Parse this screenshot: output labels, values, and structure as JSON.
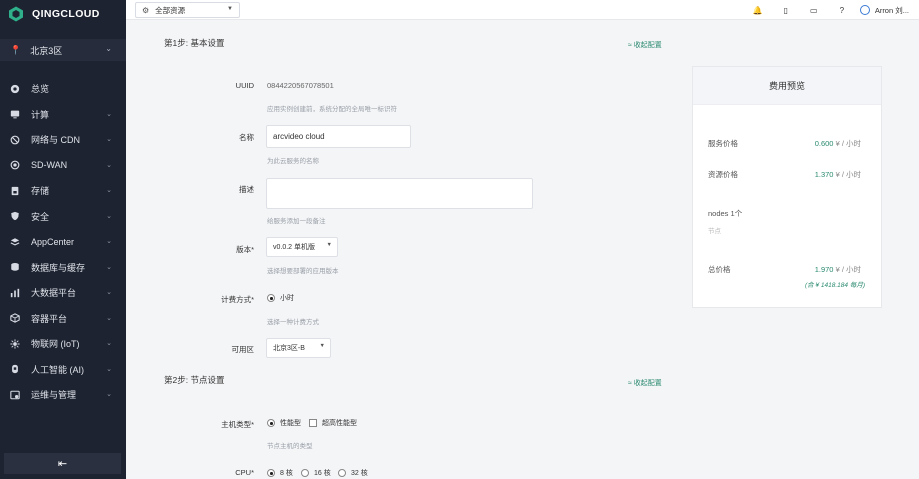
{
  "brand": {
    "name": "QINGCLOUD",
    "color": "#2fb08a"
  },
  "region": {
    "label": "北京3区",
    "icon": "location-pin-icon"
  },
  "nav": [
    {
      "label": "总览",
      "icon": "dashboard-icon",
      "chevron": false
    },
    {
      "label": "计算",
      "icon": "monitor-icon",
      "chevron": true
    },
    {
      "label": "网络与 CDN",
      "icon": "network-icon",
      "chevron": true
    },
    {
      "label": "SD-WAN",
      "icon": "sdwan-icon",
      "chevron": true
    },
    {
      "label": "存储",
      "icon": "storage-icon",
      "chevron": true
    },
    {
      "label": "安全",
      "icon": "shield-icon",
      "chevron": true
    },
    {
      "label": "AppCenter",
      "icon": "layers-icon",
      "chevron": true
    },
    {
      "label": "数据库与缓存",
      "icon": "database-icon",
      "chevron": true
    },
    {
      "label": "大数据平台",
      "icon": "bar-chart-icon",
      "chevron": true
    },
    {
      "label": "容器平台",
      "icon": "container-icon",
      "chevron": true
    },
    {
      "label": "物联网 (IoT)",
      "icon": "iot-icon",
      "chevron": true
    },
    {
      "label": "人工智能 (AI)",
      "icon": "ai-icon",
      "chevron": true
    },
    {
      "label": "运维与管理",
      "icon": "ops-icon",
      "chevron": true
    }
  ],
  "collapse_icon": "⇤",
  "topbar": {
    "resource_select": "全部资源",
    "user": "Arron 刘..."
  },
  "step1": {
    "title": "第1步: 基本设置",
    "collapse": "≈ 收起配置"
  },
  "step2": {
    "title": "第2步: 节点设置",
    "collapse": "≈ 收起配置"
  },
  "form": {
    "uuid_label": "UUID",
    "uuid_value": "0844220567078501",
    "uuid_hint": "应用实例创建前，系统分配的全局唯一标识符",
    "name_label": "名称",
    "name_value": "arcvideo cloud",
    "name_hint": "为此云服务的名称",
    "desc_label": "描述",
    "desc_hint": "给服务添加一段备注",
    "version_label": "版本*",
    "version_value": "v0.0.2 单机版",
    "version_hint": "选择想要部署的应用版本",
    "billing_label": "计费方式*",
    "billing_option": "小时",
    "billing_hint": "选择一种计费方式",
    "zone_label": "可用区",
    "zone_value": "北京3区-B",
    "host_label": "主机类型*",
    "host_opt1": "性能型",
    "host_opt2": "超高性能型",
    "host_hint": "节点主机的类型",
    "cpu_label": "CPU*",
    "cpu_opt1": "8 核",
    "cpu_opt2": "16 核",
    "cpu_opt3": "32 核"
  },
  "cost": {
    "title": "费用预览",
    "service_label": "服务价格",
    "service_value": "0.600",
    "resource_label": "资源价格",
    "resource_value": "1.370",
    "unit": "¥ / 小时",
    "nodes": "nodes 1个",
    "nodes_note": "节点",
    "total_label": "总价格",
    "total_value": "1.970",
    "monthly": "(合 ¥ 1418.184 每月)"
  }
}
